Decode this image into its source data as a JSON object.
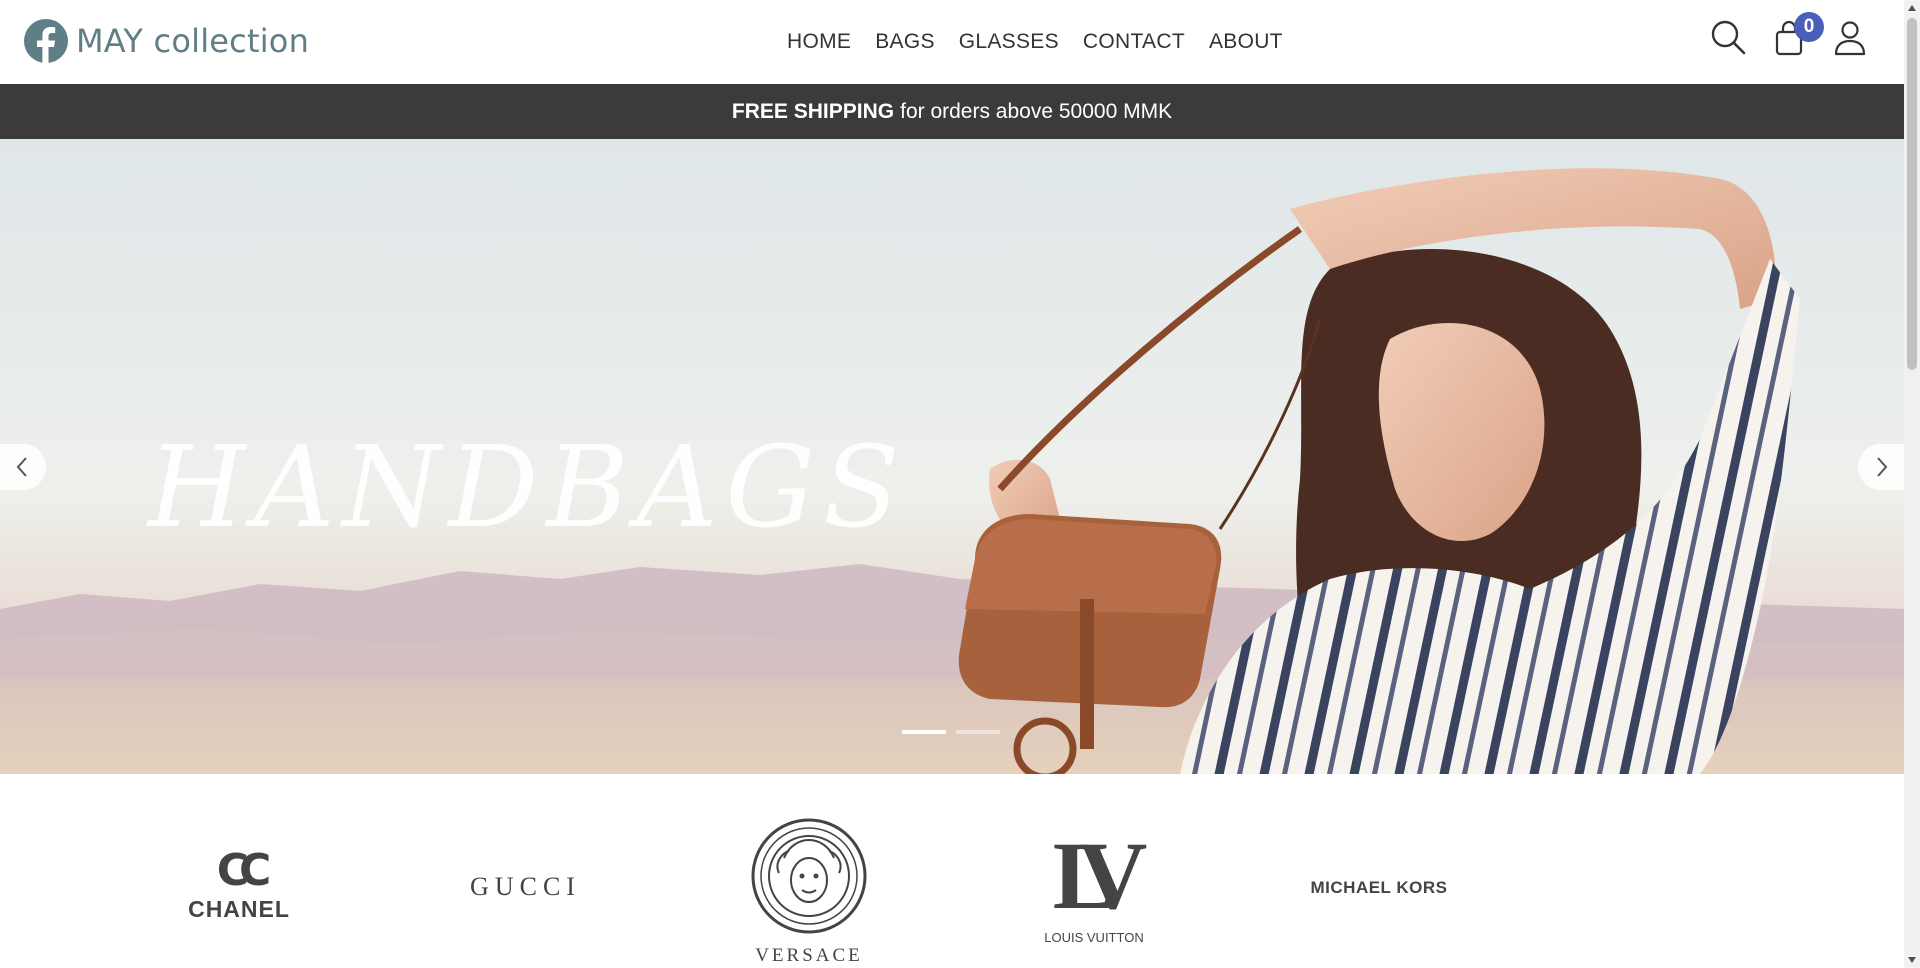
{
  "header": {
    "brand_name": "MAY collection",
    "nav": [
      "HOME",
      "BAGS",
      "GLASSES",
      "CONTACT",
      "ABOUT"
    ],
    "cart_count": "0",
    "icons": [
      "facebook-icon",
      "search-icon",
      "shopping-bag-icon",
      "user-icon"
    ]
  },
  "promo": {
    "bold": "FREE SHIPPING",
    "text": "for orders above 50000 MMK"
  },
  "hero": {
    "title": "HANDBAGS",
    "active_slide": 1,
    "slide_count": 2
  },
  "brands": {
    "chanel_mark": "CC",
    "chanel": "CHANEL",
    "gucci": "GUCCI",
    "versace": "VERSACE",
    "lv_mark": "LV",
    "louis_vuitton": "LOUIS VUITTON",
    "michael_kors": "MICHAEL KORS"
  },
  "colors": {
    "brand": "#5f7f86",
    "promo_bg": "#3b3b3b",
    "badge": "#4a5fb8"
  }
}
